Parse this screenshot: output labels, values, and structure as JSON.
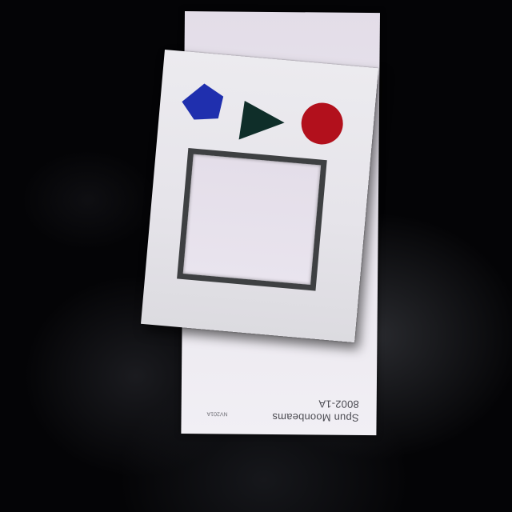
{
  "swatch": {
    "name": "Spun Moonbeams",
    "code": "8002-1A",
    "small_code": "NV201A"
  },
  "shapes": [
    {
      "icon": "pentagon-icon",
      "color": "#1f2fae"
    },
    {
      "icon": "triangle-icon",
      "color": "#0f2e29"
    },
    {
      "icon": "circle-icon",
      "color": "#b2101c"
    }
  ],
  "frame": {
    "border_color": "#3e4042"
  }
}
